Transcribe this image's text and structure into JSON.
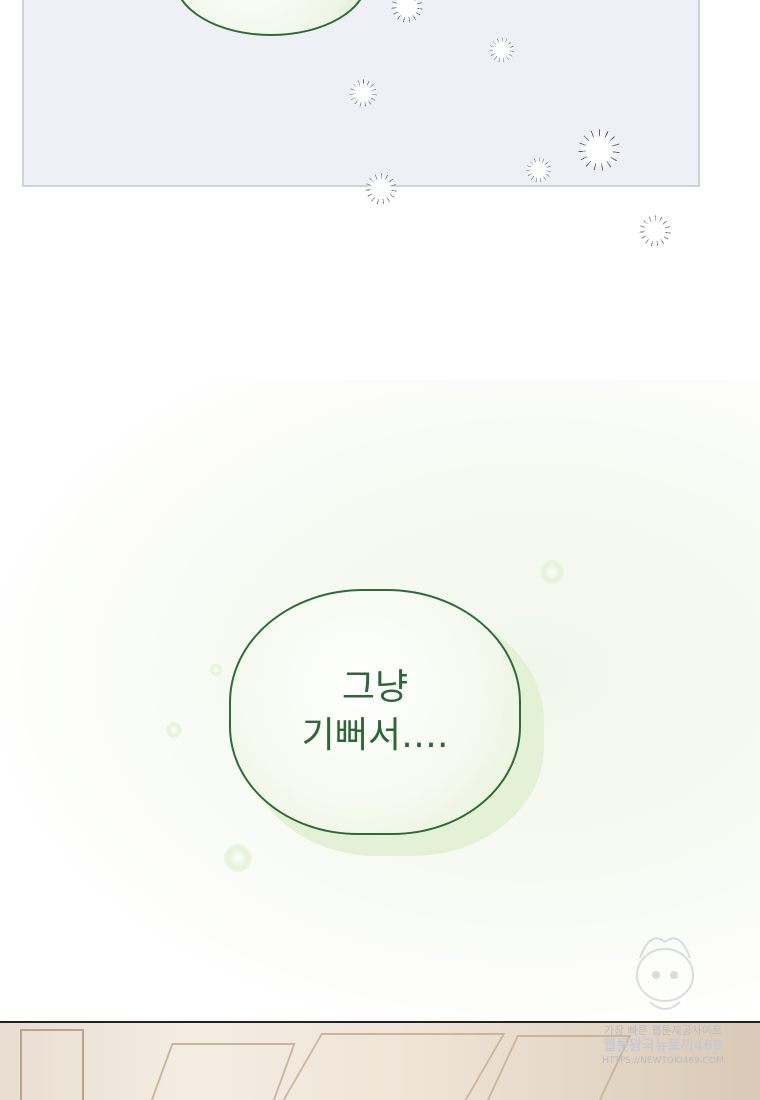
{
  "speech_bubble": {
    "line1": "그냥",
    "line2": "기뻐서…."
  },
  "watermark": {
    "line1": "가장 빠른 웹툰제공사이트",
    "line2": "웹툰왕국뉴토끼469",
    "line3": "HTTPS://NEWTOKI469.COM"
  },
  "colors": {
    "bubble_border": "#2f6b3a",
    "bubble_text": "#2e6638",
    "panel_bg": "#eef0f6",
    "bubble_glow": "#e4f1d6"
  }
}
